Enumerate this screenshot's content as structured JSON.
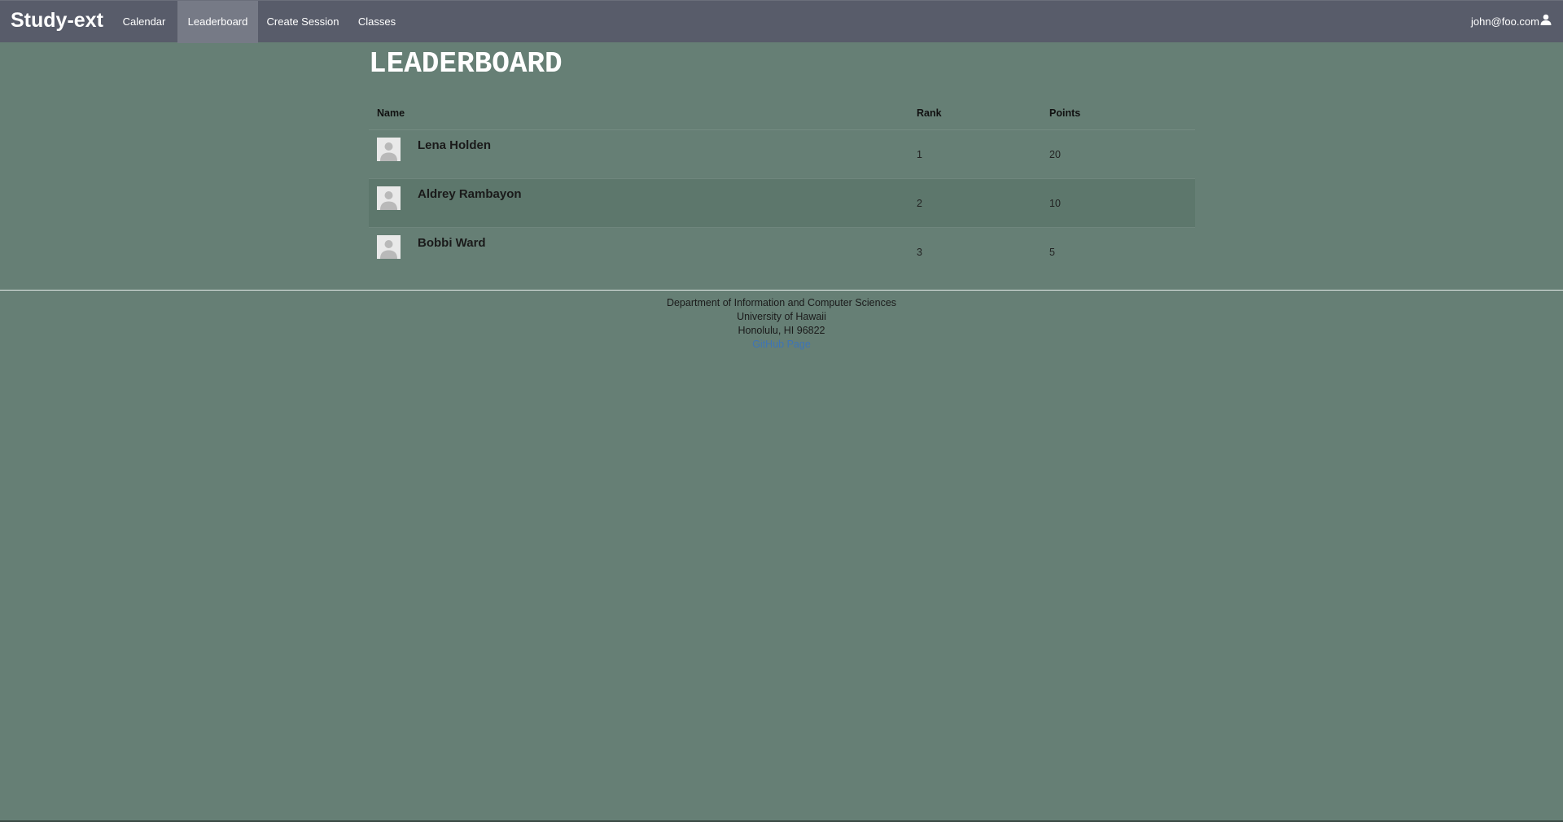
{
  "navbar": {
    "brand": "Study-ext",
    "items": [
      {
        "label": "Calendar"
      },
      {
        "label": "Leaderboard"
      },
      {
        "label": "Create Session"
      },
      {
        "label": "Classes"
      }
    ],
    "active": "Leaderboard",
    "user": "john@foo.com",
    "user_icon": "user-icon"
  },
  "page": {
    "title": "LEADERBOARD"
  },
  "leaderboard": {
    "columns": [
      "Name",
      "Rank",
      "Points"
    ],
    "rows": [
      {
        "name": "Lena Holden",
        "rank": "1",
        "points": "20",
        "avatar_icon": "user-avatar-icon"
      },
      {
        "name": "Aldrey Rambayon",
        "rank": "2",
        "points": "10",
        "avatar_icon": "user-avatar-icon"
      },
      {
        "name": "Bobbi Ward",
        "rank": "3",
        "points": "5",
        "avatar_icon": "user-avatar-icon"
      }
    ]
  },
  "footer": {
    "line1": "Department of Information and Computer Sciences",
    "line2": "University of Hawaii",
    "line3": "Honolulu, HI 96822",
    "link": "GitHub Page"
  },
  "colors": {
    "background": "#667f75",
    "navbar": "#585c6a",
    "navbar_active": "#767a86",
    "striped_row": "#5d776c",
    "link": "#3e74b6"
  }
}
